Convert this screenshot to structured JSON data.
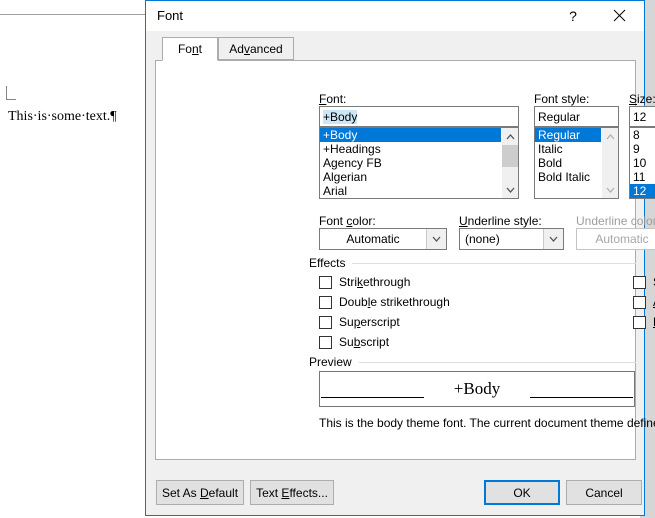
{
  "document": {
    "body_text": "This·is·some·text.¶"
  },
  "dialog": {
    "title": "Font",
    "titlebar": {
      "help_label": "?",
      "help_icon": "question-mark-icon",
      "close_icon": "close-icon"
    },
    "tabs": [
      {
        "label": "Font",
        "mnemonic_index": 2,
        "active": true
      },
      {
        "label": "Advanced",
        "mnemonic_index": 2,
        "active": false
      }
    ],
    "font_section": {
      "font_label": "Font:",
      "font_label_mnemonic": "F",
      "font_value": "+Body",
      "font_list": [
        "+Body",
        "+Headings",
        "Agency FB",
        "Algerian",
        "Arial"
      ],
      "font_selected": "+Body",
      "style_label": "Font style:",
      "style_value": "Regular",
      "style_list": [
        "Regular",
        "Italic",
        "Bold",
        "Bold Italic"
      ],
      "style_selected": "Regular",
      "size_label": "Size:",
      "size_label_mnemonic": "S",
      "size_value": "12",
      "size_list": [
        "8",
        "9",
        "10",
        "11",
        "12"
      ],
      "size_selected": "12"
    },
    "color_section": {
      "font_color_label": "Font color:",
      "font_color_value": "Automatic",
      "underline_style_label": "Underline style:",
      "underline_style_value": "(none)",
      "underline_color_label": "Underline color:",
      "underline_color_value": "Automatic",
      "underline_color_disabled": true
    },
    "effects": {
      "group_label": "Effects",
      "left_column": [
        {
          "label": "Strikethrough",
          "checked": false,
          "mnemonic_index": 4
        },
        {
          "label": "Double strikethrough",
          "checked": false,
          "mnemonic_index": 5
        },
        {
          "label": "Superscript",
          "checked": false,
          "mnemonic_index": 5
        },
        {
          "label": "Subscript",
          "checked": false,
          "mnemonic_index": 3
        }
      ],
      "right_column": [
        {
          "label": "Small caps",
          "checked": false,
          "mnemonic_index": 1
        },
        {
          "label": "All caps",
          "checked": false,
          "mnemonic_index": 0
        },
        {
          "label": "Hidden",
          "checked": false,
          "mnemonic_index": 0
        }
      ]
    },
    "preview": {
      "group_label": "Preview",
      "sample_text": "+Body",
      "description": "This is the body theme font. The current document theme defines which font will be used."
    },
    "buttons": {
      "set_as_default": "Set As Default",
      "text_effects": "Text Effects...",
      "ok": "OK",
      "cancel": "Cancel"
    }
  },
  "colors": {
    "accent": "#0078d7",
    "dialog_face": "#f0f0f0",
    "selection_fill": "#cde6f7",
    "scroll_thumb": "#cdcdcd"
  }
}
